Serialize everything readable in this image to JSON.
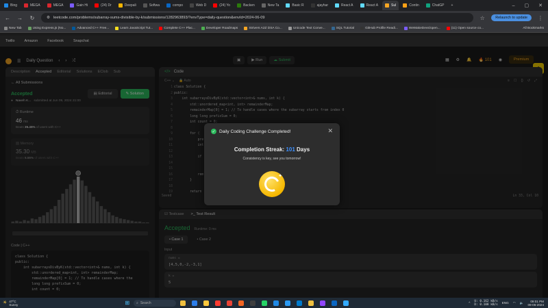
{
  "browser": {
    "tabs": [
      {
        "label": "Bing",
        "color": "#1e88e5"
      },
      {
        "label": "MEGA",
        "color": "#d9272e"
      },
      {
        "label": "MEGA",
        "color": "#d9272e"
      },
      {
        "label": "Gain Hi",
        "color": "#7b5cff"
      },
      {
        "label": "(24) Dr",
        "color": "#ff0000"
      },
      {
        "label": "Deepali",
        "color": "#f4b400"
      },
      {
        "label": "Softwa",
        "color": "#555"
      },
      {
        "label": "compo",
        "color": "#0a66c2"
      },
      {
        "label": "Web D",
        "color": "#444"
      },
      {
        "label": "(24) Yo",
        "color": "#ff0000"
      },
      {
        "label": "Backen",
        "color": "#2b7a0b"
      },
      {
        "label": "New Ta",
        "color": "#666"
      },
      {
        "label": "Basic R",
        "color": "#61dafb"
      },
      {
        "label": "ajayhar",
        "color": "#333"
      },
      {
        "label": "React A",
        "color": "#61dafb"
      },
      {
        "label": "React A",
        "color": "#61dafb"
      },
      {
        "label": "Sul",
        "color": "#f5a623",
        "active": true
      },
      {
        "label": "Contin",
        "color": "#ffa116"
      },
      {
        "label": "ChatGP",
        "color": "#10a37f"
      }
    ],
    "url": "leetcode.com/problems/subarray-sums-divisible-by-k/submissions/1282963893/?envType=daily-question&envId=2024-06-09",
    "relaunch_label": "Relaunch to update",
    "bookmarks": [
      "New Tab",
      "Using Express.js (No...",
      "Advanced C++ Free...",
      "Learn JavaScript Tut...",
      "Complete C++ Plac...",
      "Developer Roadmaps",
      "Strivers A2Z DSA Co...",
      "Unicode Text Conve...",
      "SQL Tutorial",
      "GitHub Profile Readi...",
      "WeMakeDevs/open...",
      "(11) Open source co..."
    ],
    "all_bookmarks": "All Bookmarks",
    "ext_links": [
      "Twillo",
      "Amazon",
      "Facebook",
      "Snapchat"
    ]
  },
  "lc": {
    "daily_question": "Daily Question",
    "run_label": "Run",
    "submit_label": "Submit",
    "streak": "101",
    "premium": "Premium",
    "left_tabs": [
      "Description",
      "Accepted",
      "Editorial",
      "Solutions",
      "EClob",
      "Sub"
    ],
    "all_submissions": "All Submissions",
    "status": "Accepted",
    "editorial_btn": "Editorial",
    "solution_btn": "Solution",
    "author": "Naveh K...",
    "submitted_at": "submitted at Jun 09, 2024 21:00",
    "runtime_label": "Runtime",
    "runtime_value": "46",
    "runtime_unit": "ms",
    "runtime_beats_prefix": "Beats",
    "runtime_beats": "35.45%",
    "runtime_beats_suffix": "of users with C++",
    "memory_label": "Memory",
    "memory_value": "35.30",
    "memory_unit": "MB",
    "memory_beats_prefix": "Beats",
    "memory_beats": "5.55%",
    "memory_beats_suffix": "of users with C++",
    "code_label": "Code | C++",
    "code_snippet": [
      "class Solution {",
      "public:",
      "    int subarraysDivByK(std::vector<int>& nums, int k) {",
      "        std::unordered_map<int, int> remainderMap;",
      "        remainderMap[0] = 1; // To handle cases where the",
      "        long long prefixSum = 0;",
      "        int count = 0;"
    ],
    "editor": {
      "title": "Code",
      "language": "C++",
      "auto": "Auto",
      "saved": "Saved",
      "cursor": "Ln 33, Col 10",
      "line_numbers": [
        "1",
        "2",
        "3",
        "4",
        "5",
        "6",
        "7",
        "8",
        "9",
        "10",
        "11",
        "12",
        "13",
        "14",
        "15",
        "16",
        "17",
        "18",
        "19"
      ],
      "lines": [
        "class Solution {",
        "public:",
        "    int subarraysDivByK(std::vector<int>& nums, int k) {",
        "        std::unordered_map<int, int> remainderMap;",
        "        remainderMap[0] = 1; // To handle cases where the subarray starts from index 0",
        "        long long prefixSum = 0;",
        "        int count = 0;",
        "",
        "        for (",
        "            pre",
        "            int",
        "",
        "            if",
        "",
        "",
        "            rem",
        "        }",
        "",
        "        return"
      ]
    },
    "test": {
      "tab_testcase": "Testcase",
      "tab_result": "Test Result",
      "status": "Accepted",
      "runtime": "Runtime: 0 ms",
      "cases": [
        "Case 1",
        "Case 2"
      ],
      "input_label": "Input",
      "input_name": "nums =",
      "input_value": "[4,5,0,-2,-3,1]",
      "k_name": "k =",
      "k_value": "5"
    }
  },
  "modal": {
    "title": "Daily Coding Challenge Completed!",
    "streak_prefix": "Completion Streak:",
    "streak_number": "101",
    "streak_suffix": "Days",
    "message": "Consistency is key, see you tomorrow!"
  },
  "chart_data": {
    "type": "bar",
    "values": [
      2,
      3,
      2,
      4,
      3,
      6,
      5,
      8,
      10,
      14,
      18,
      22,
      30,
      38,
      44,
      50,
      56,
      60,
      55,
      48,
      40,
      34,
      28,
      22,
      18,
      14,
      10,
      8,
      6,
      5,
      4,
      3,
      2,
      2,
      1,
      1
    ],
    "highlight_index": 17
  },
  "taskbar": {
    "temp": "47°C",
    "weather": "Sunny",
    "search": "Search",
    "up": "0.162 kB/s",
    "down": "0.108 kB/s",
    "lang": "ENG",
    "time": "09:01 PM",
    "date": "09-06-2024",
    "app_colors": [
      "#f0c040",
      "#2b7de9",
      "#ffc83d",
      "#ff3b30",
      "#ea4335",
      "#f26522",
      "#3e3e3e",
      "#25d366",
      "#1e88e5",
      "#2b9af3",
      "#007acc",
      "#f0c040",
      "#9146ff",
      "#0a66c2",
      "#33aaff"
    ]
  }
}
